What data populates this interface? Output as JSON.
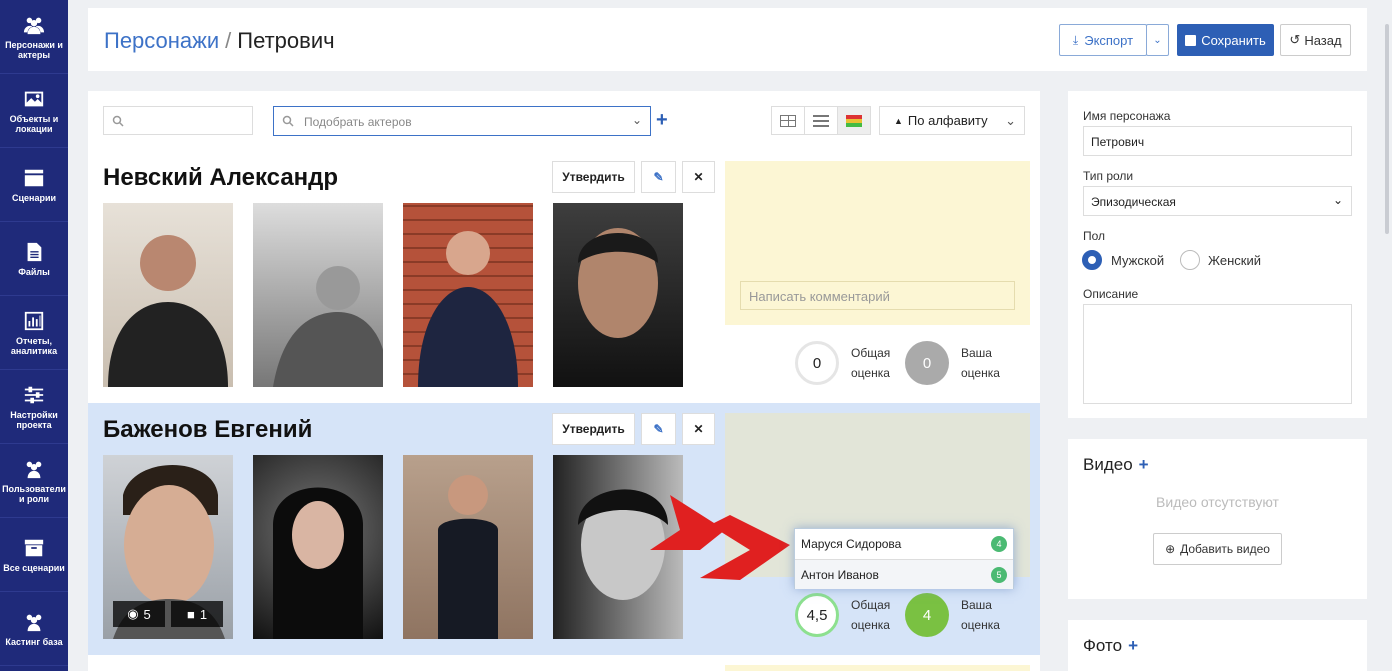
{
  "sidebar": [
    {
      "label": "Персонажи и актеры",
      "icon": "users-icon"
    },
    {
      "label": "Объекты и локации",
      "icon": "image-icon"
    },
    {
      "label": "Сценарии",
      "icon": "clapper-icon"
    },
    {
      "label": "Файлы",
      "icon": "file-icon"
    },
    {
      "label": "Отчеты, аналитика",
      "icon": "chart-icon"
    },
    {
      "label": "Настройки проекта",
      "icon": "sliders-icon"
    },
    {
      "label": "Пользователи и роли",
      "icon": "users-icon"
    },
    {
      "label": "Все сценарии",
      "icon": "archive-icon"
    },
    {
      "label": "Кастинг база",
      "icon": "users-icon"
    }
  ],
  "header": {
    "crumb_link": "Персонажи",
    "crumb_sep": "/",
    "crumb_current": "Петрович",
    "export_label": "Экспорт",
    "save_label": "Сохранить",
    "back_label": "Назад"
  },
  "toolbar": {
    "actor_search_placeholder": "Подобрать актеров",
    "sort_label": "По алфавиту"
  },
  "actors": [
    {
      "name": "Невский Александр",
      "approve_label": "Утвердить",
      "comment_placeholder": "Написать комментарий",
      "overall_score": "0",
      "overall_label_1": "Общая",
      "overall_label_2": "оценка",
      "your_score": "0",
      "your_label_1": "Ваша",
      "your_label_2": "оценка"
    },
    {
      "name": "Баженов Евгений",
      "approve_label": "Утвердить",
      "photo_count": "5",
      "video_count": "1",
      "overall_score": "4,5",
      "overall_label_1": "Общая",
      "overall_label_2": "оценка",
      "your_score": "4",
      "your_label_1": "Ваша",
      "your_label_2": "оценка",
      "ratings_popup": [
        {
          "name": "Маруся Сидорова",
          "score": "4"
        },
        {
          "name": "Антон Иванов",
          "score": "5"
        }
      ]
    }
  ],
  "character": {
    "name_label": "Имя персонажа",
    "name_value": "Петрович",
    "role_type_label": "Тип роли",
    "role_type_value": "Эпизодическая",
    "gender_label": "Пол",
    "gender_male": "Мужской",
    "gender_female": "Женский",
    "description_label": "Описание"
  },
  "video": {
    "title": "Видео",
    "empty_text": "Видео отсутствуют",
    "add_label": "Добавить видео"
  },
  "photo": {
    "title": "Фото"
  },
  "colors": {
    "sidebar": "#1f2a7a",
    "accent": "#2d5fb5",
    "highlight_row": "#d6e4f8",
    "comment_bg": "#fcf6d4",
    "arrow": "#e02020"
  }
}
